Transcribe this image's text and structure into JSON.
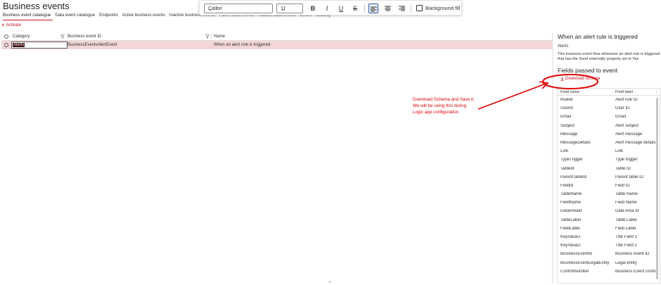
{
  "page": {
    "title": "Business events"
  },
  "tabs": [
    "Business event catalogue",
    "Data event catalogue",
    "Endpoints",
    "Active business events",
    "Inactive business events",
    "Active data events",
    "Inactive data events",
    "Errors",
    "Security"
  ],
  "toolbar": {
    "activate_label": "Activate"
  },
  "grid": {
    "columns": {
      "category": "Category",
      "event_id": "Business event ID",
      "name": "Name"
    },
    "rows": [
      {
        "category": "Alerts",
        "event_id": "BusinessEventsAlertEvent",
        "name": "When an alert rule is triggered"
      }
    ]
  },
  "pane": {
    "title": "When an alert rule is triggered",
    "category": "Alerts",
    "description": "This business event fires whenever an alert rule is triggered that has the Send externally property set to Yes",
    "fields_heading": "Fields passed to event",
    "download_label": "Download schema",
    "columns": {
      "name": "Field name",
      "label": "Field label"
    },
    "fields": [
      {
        "name": "RuleId",
        "label": "Alert rule ID"
      },
      {
        "name": "UserId",
        "label": "User ID"
      },
      {
        "name": "Email",
        "label": "Email"
      },
      {
        "name": "Subject",
        "label": "Alert subject"
      },
      {
        "name": "Message",
        "label": "Alert message"
      },
      {
        "name": "MessageDetails",
        "label": "Alert message details"
      },
      {
        "name": "Link",
        "label": "Link"
      },
      {
        "name": "TypeTrigger",
        "label": "Type trigger"
      },
      {
        "name": "TableId",
        "label": "Table ID"
      },
      {
        "name": "ParentTableId",
        "label": "Parent table ID"
      },
      {
        "name": "FieldId",
        "label": "Field ID"
      },
      {
        "name": "TableName",
        "label": "Table Name"
      },
      {
        "name": "FieldName",
        "label": "Field Name"
      },
      {
        "name": "DataAreaId",
        "label": "Data Area Id"
      },
      {
        "name": "TableLabel",
        "label": "Table Label"
      },
      {
        "name": "FieldLabel",
        "label": "Field Label"
      },
      {
        "name": "KeyValue1",
        "label": "Title Field 1"
      },
      {
        "name": "KeyValue2",
        "label": "Title Field 2"
      },
      {
        "name": "BusinessEventId",
        "label": "Business event ID"
      },
      {
        "name": "BusinessEventLegalEntity",
        "label": "Legal entity"
      },
      {
        "name": "ControlNumber",
        "label": "Business Event control"
      }
    ]
  },
  "format_bar": {
    "font": "Calibri",
    "size": "11",
    "bold": "B",
    "italic": "I",
    "underline": "U",
    "strike": "S",
    "background_fill_label": "Background fill"
  },
  "annotation": {
    "line1": "Download Schema and Save it.",
    "line2": "We will be using this during",
    "line3": "Logic app configuration"
  },
  "colors": {
    "accent": "#c50f1f",
    "annotation": "#e00000",
    "selected_row": "#f3d6d8"
  }
}
